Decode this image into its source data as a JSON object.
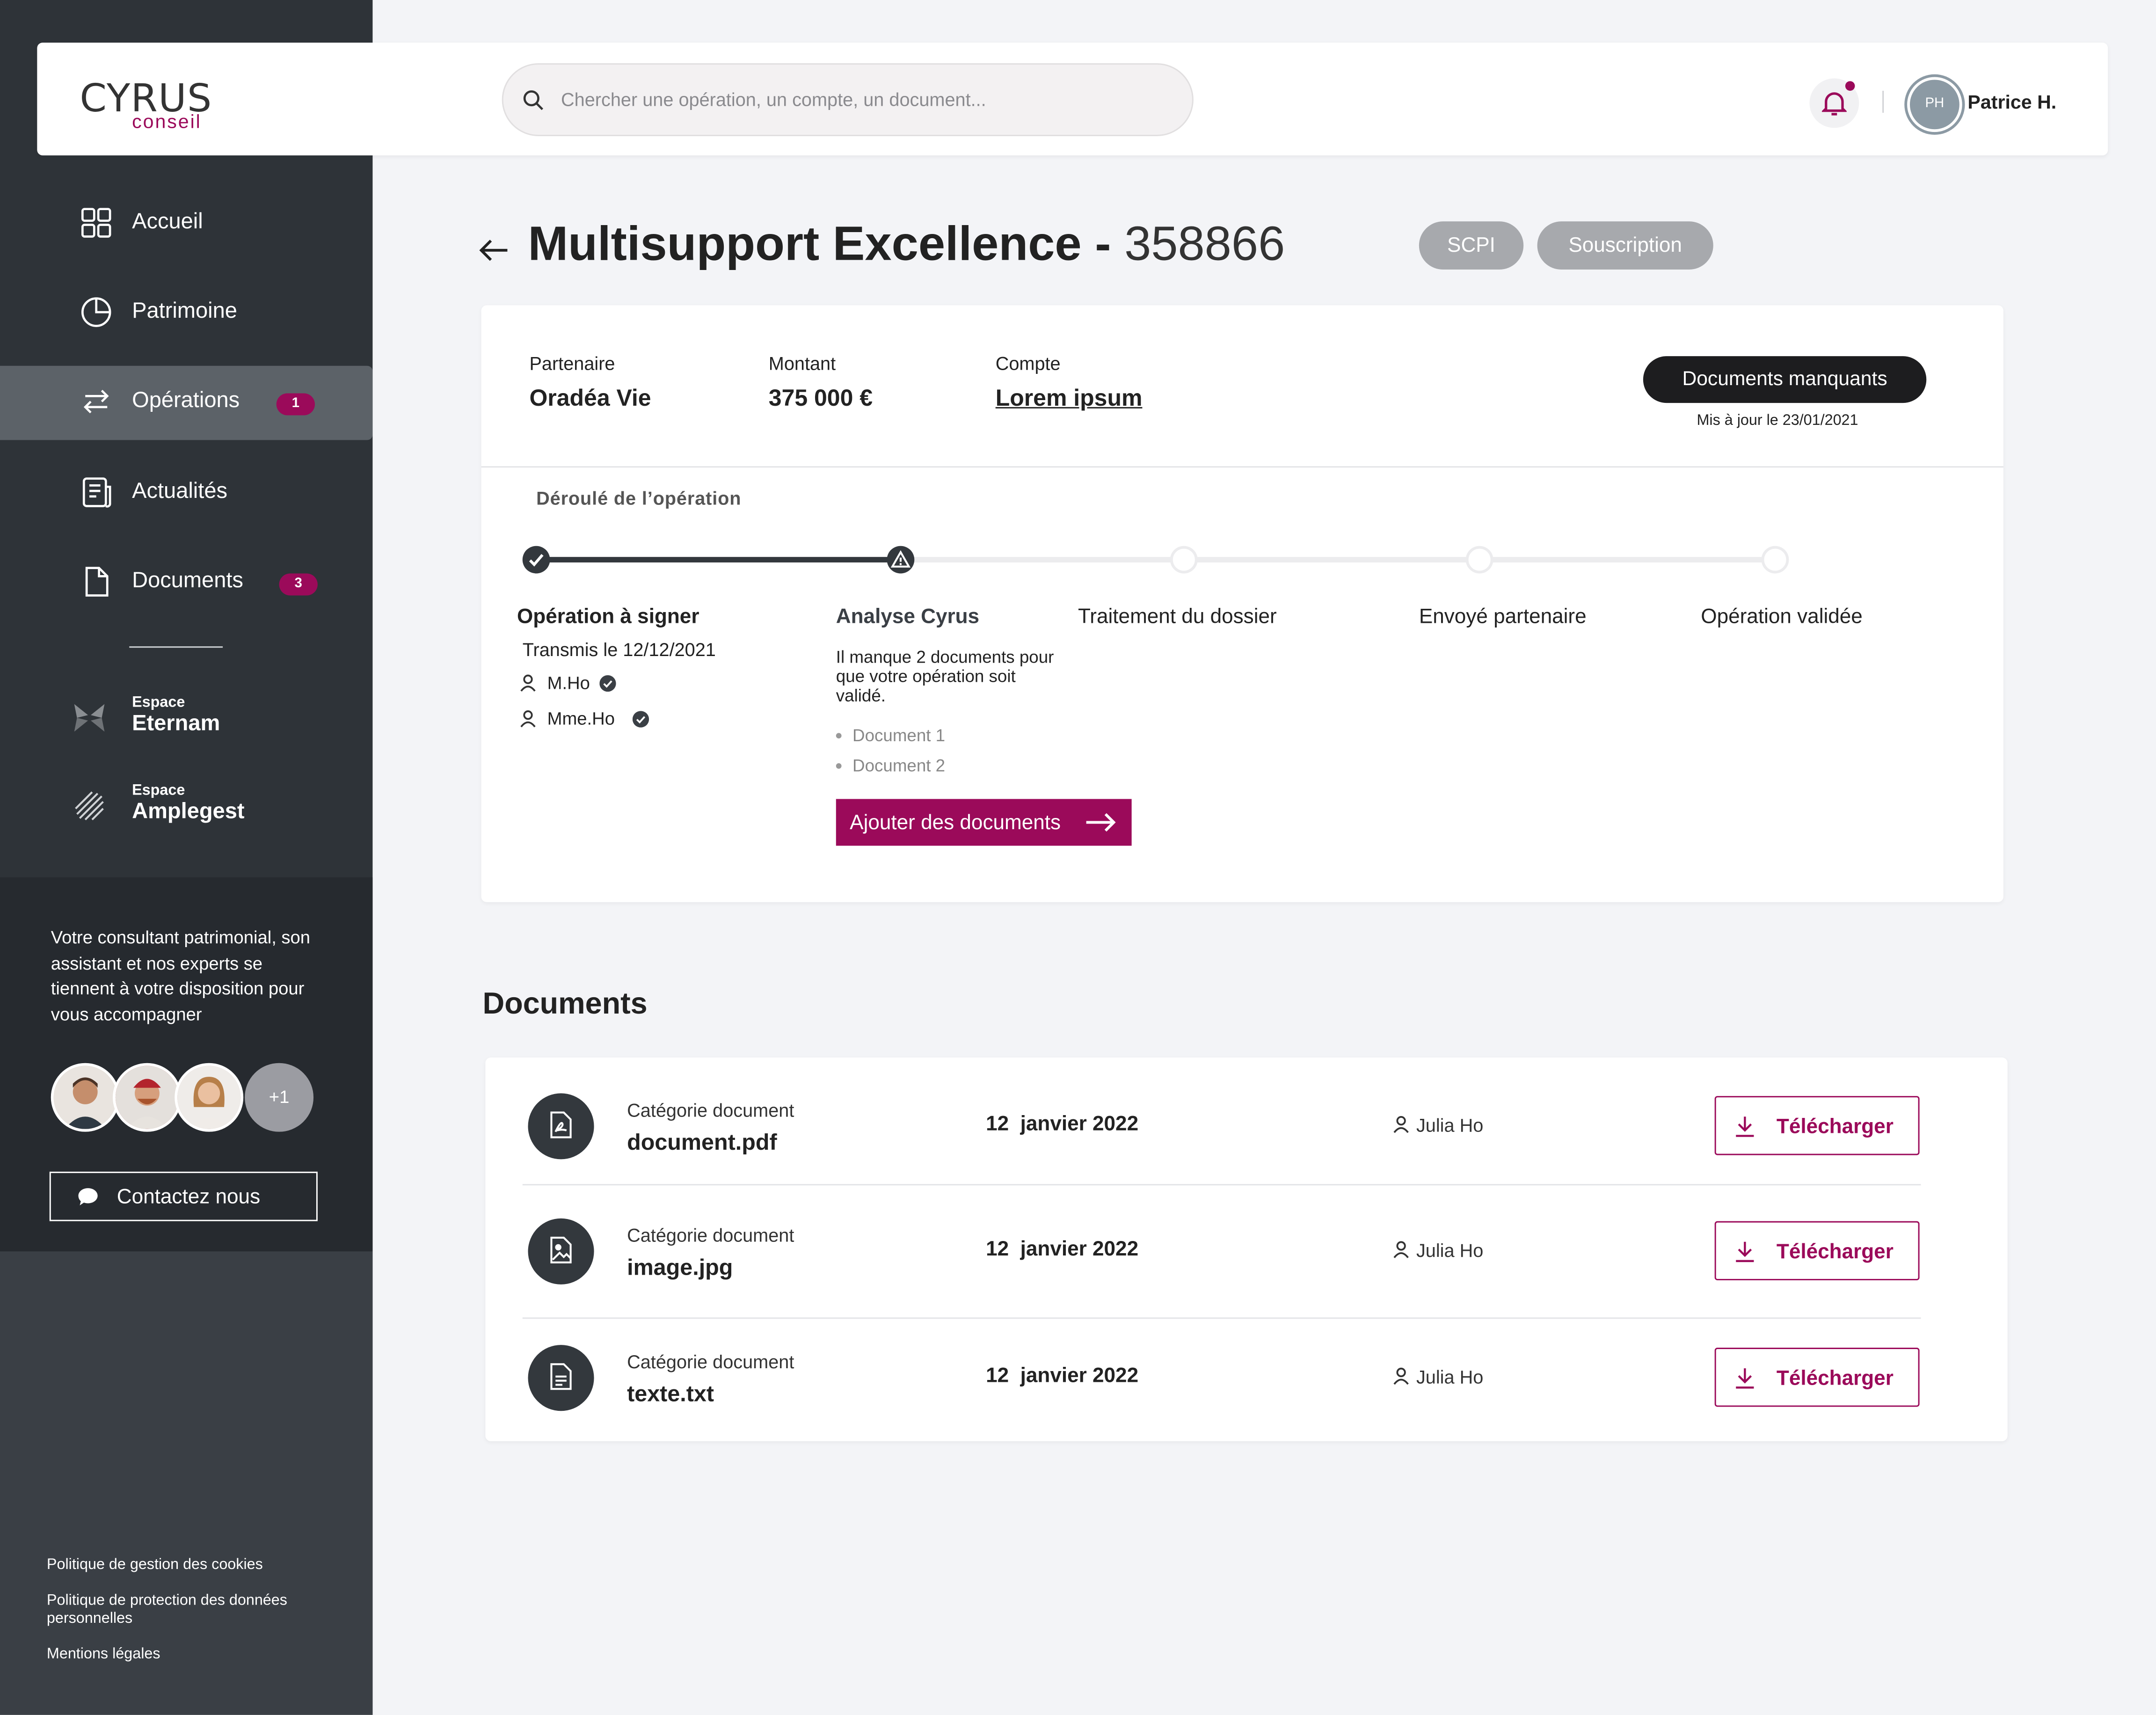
{
  "brand": {
    "name": "CYRUS",
    "sub": "conseil",
    "accent": "#9b0a5a"
  },
  "search": {
    "placeholder": "Chercher une opération, un compte, un document..."
  },
  "user": {
    "initials": "PH",
    "name": "Patrice H."
  },
  "sidebar": {
    "items": [
      {
        "label": "Accueil",
        "icon": "grid-icon"
      },
      {
        "label": "Patrimoine",
        "icon": "pie-chart-icon"
      },
      {
        "label": "Opérations",
        "icon": "arrows-icon",
        "badge": "1",
        "active": true
      },
      {
        "label": "Actualités",
        "icon": "news-icon"
      },
      {
        "label": "Documents",
        "icon": "document-icon",
        "badge": "3"
      }
    ],
    "espaces": [
      {
        "small": "Espace",
        "name": "Eternam"
      },
      {
        "small": "Espace",
        "name": "Amplegest"
      }
    ],
    "consult_text": "Votre consultant patrimonial, son assistant et nos experts se tiennent à votre disposition pour vous accompagner",
    "more_count": "+1",
    "contact_label": "Contactez nous",
    "footer_links": [
      "Politique de gestion des cookies",
      "Politique de protection des données personnelles",
      "Mentions légales"
    ]
  },
  "page": {
    "title": "Multisupport Excellence -",
    "number": "358866",
    "tags": [
      "SCPI",
      "Souscription"
    ]
  },
  "summary": {
    "partner_label": "Partenaire",
    "partner_value": "Oradéa Vie",
    "amount_label": "Montant",
    "amount_value": "375 000 €",
    "account_label": "Compte",
    "account_value": "Lorem ipsum",
    "status_button": "Documents manquants",
    "updated": "Mis à jour le 23/01/2021"
  },
  "timeline": {
    "heading": "Déroulé de l’opération",
    "steps": [
      {
        "title": "Opération à signer",
        "state": "done"
      },
      {
        "title": "Analyse Cyrus",
        "state": "warning"
      },
      {
        "title": "Traitement du dossier",
        "state": "todo"
      },
      {
        "title": "Envoyé partenaire",
        "state": "todo"
      },
      {
        "title": "Opération validée",
        "state": "todo"
      }
    ],
    "step1": {
      "sent": "Transmis le 12/12/2021",
      "signers": [
        "M.Ho",
        "Mme.Ho"
      ]
    },
    "step2": {
      "message": "Il manque 2 documents pour que votre opération soit validé.",
      "docs": [
        "Document 1",
        "Document 2"
      ],
      "button": "Ajouter des documents"
    }
  },
  "documents": {
    "heading": "Documents",
    "rows": [
      {
        "category": "Catégorie document",
        "name": "document.pdf",
        "date": "12  janvier 2022",
        "owner": "Julia Ho",
        "action": "Télécharger",
        "icon": "pdf-icon"
      },
      {
        "category": "Catégorie document",
        "name": "image.jpg",
        "date": "12  janvier 2022",
        "owner": "Julia Ho",
        "action": "Télécharger",
        "icon": "image-file-icon"
      },
      {
        "category": "Catégorie document",
        "name": "texte.txt",
        "date": "12  janvier 2022",
        "owner": "Julia Ho",
        "action": "Télécharger",
        "icon": "text-file-icon"
      }
    ]
  }
}
